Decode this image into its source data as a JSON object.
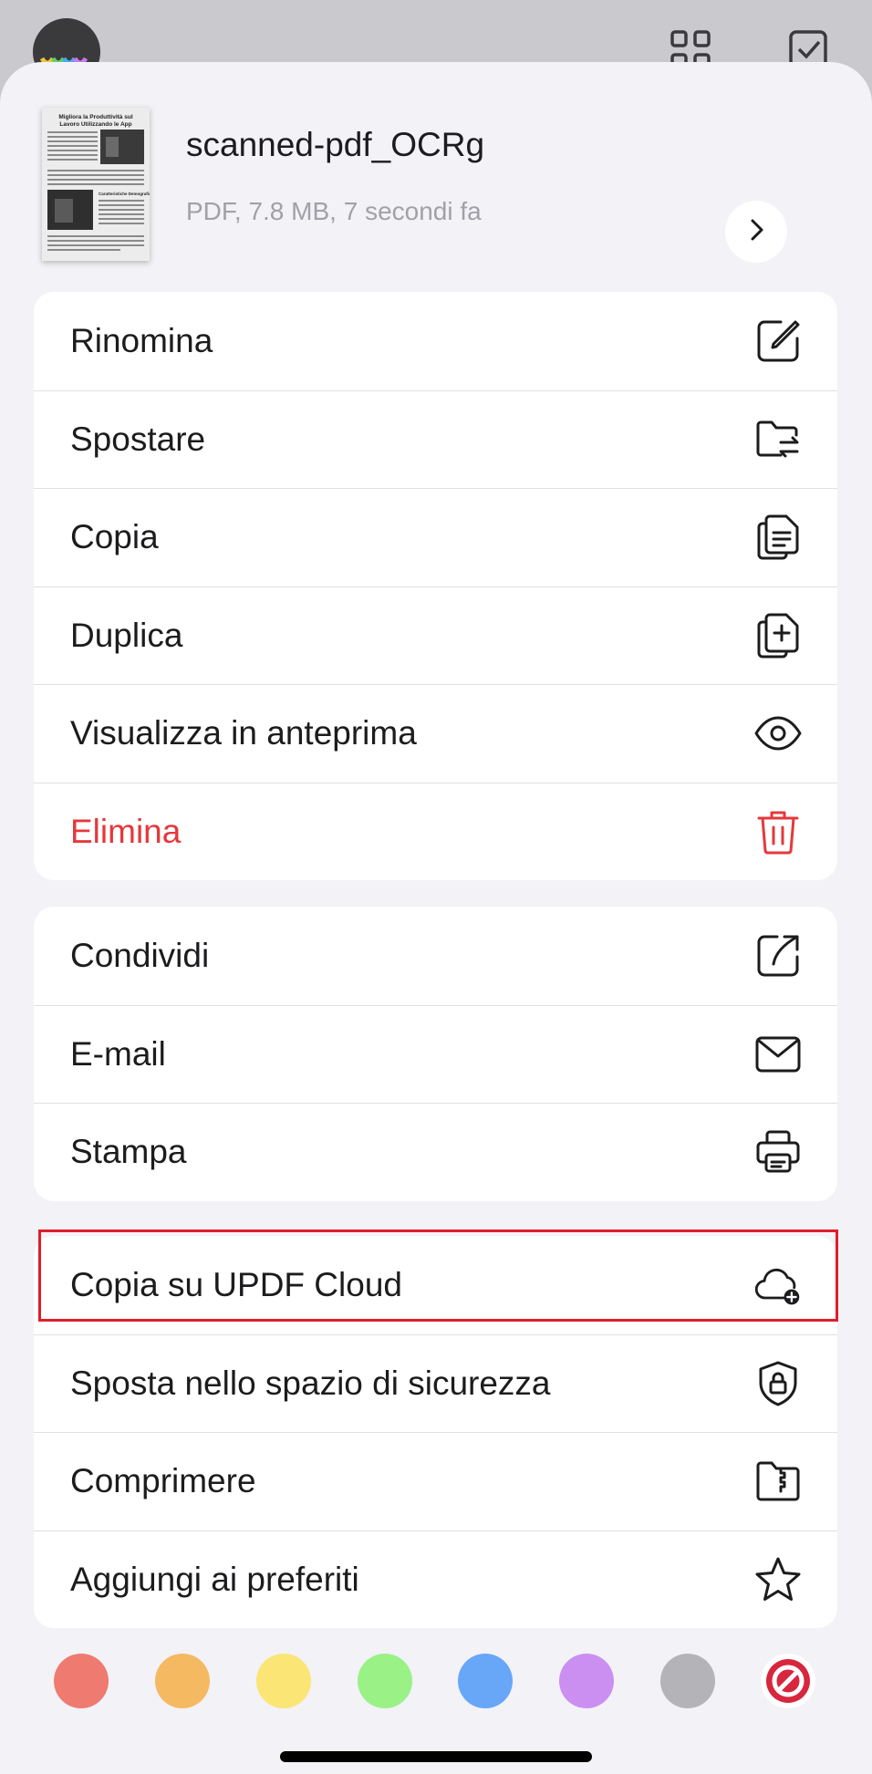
{
  "file": {
    "name": "scanned-pdf_OCRg",
    "meta": "PDF, 7.8 MB, 7 secondi fa",
    "thumbnail_title": "Migliora la Produttività sul Lavoro Utilizzando le App",
    "thumbnail_subtitle": "Caratteristiche Demografiche"
  },
  "groups": [
    {
      "items": [
        {
          "label": "Rinomina",
          "icon": "rename-icon"
        },
        {
          "label": "Spostare",
          "icon": "move-folder-icon"
        },
        {
          "label": "Copia",
          "icon": "copy-icon"
        },
        {
          "label": "Duplica",
          "icon": "duplicate-icon"
        },
        {
          "label": "Visualizza in anteprima",
          "icon": "eye-icon"
        },
        {
          "label": "Elimina",
          "icon": "trash-icon"
        }
      ]
    },
    {
      "items": [
        {
          "label": "Condividi",
          "icon": "share-icon"
        },
        {
          "label": "E-mail",
          "icon": "mail-icon"
        },
        {
          "label": "Stampa",
          "icon": "printer-icon"
        }
      ]
    },
    {
      "items": [
        {
          "label": "Copia su UPDF Cloud",
          "icon": "cloud-add-icon",
          "highlighted": true
        },
        {
          "label": "Sposta nello spazio di sicurezza",
          "icon": "shield-lock-icon"
        },
        {
          "label": "Comprimere",
          "icon": "zip-folder-icon"
        },
        {
          "label": "Aggiungi ai preferiti",
          "icon": "star-icon"
        }
      ]
    }
  ],
  "colors": {
    "accent_danger": "#e5383b",
    "highlight_border": "#e01e2a",
    "swatches": [
      "#ef7a70",
      "#f5b961",
      "#fbe574",
      "#9af185",
      "#68a6f8",
      "#cb8ff2",
      "#b4b4b8"
    ],
    "no_color": "#d7263d"
  }
}
